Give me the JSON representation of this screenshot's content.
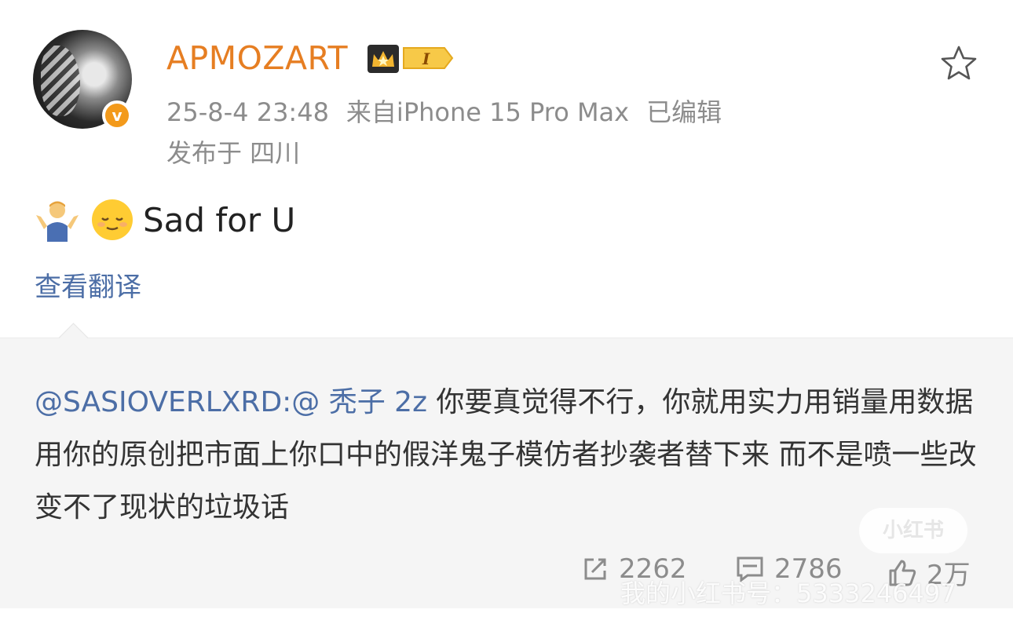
{
  "post": {
    "username": "APMOZART",
    "level_badge": "I",
    "time": "25-8-4 23:48",
    "source": "来自iPhone 15 Pro Max",
    "edited": "已编辑",
    "location": "发布于 四川",
    "content": "Sad for U",
    "translate_label": "查看翻译",
    "icons": {
      "verified": "verified-v-icon",
      "crown": "crown-icon",
      "favorite": "star-icon",
      "emoji_1": "person-shrugging-emoji",
      "emoji_2": "relieved-face-emoji"
    }
  },
  "repost": {
    "mention": "@SASIOVERLXRD:@ 秃子 2z",
    "text": " 你要真觉得不行，你就用实力用销量用数据用你的原创把市面上你口中的假洋鬼子模仿者抄袭者替下来  而不是喷一些改变不了现状的垃圾话",
    "stats": {
      "repost_count": "2262",
      "comment_count": "2786",
      "like_count": "2万"
    },
    "watermark_badge": "小红书",
    "watermark_text": "我的小红书号：5333246497"
  },
  "colors": {
    "username": "#e67e22",
    "link": "#4c6ea6",
    "meta": "#8c8c8c",
    "repost_bg": "#f5f5f5"
  }
}
